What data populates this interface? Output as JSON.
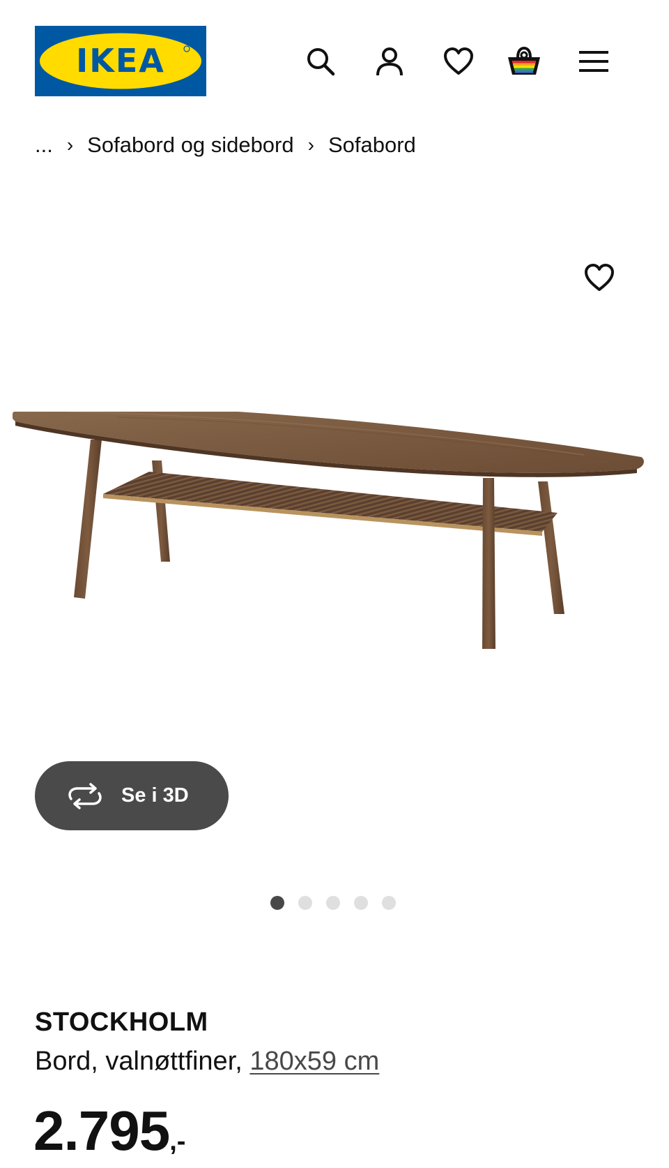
{
  "header": {
    "logo_text": "IKEA",
    "brand_colors": {
      "blue": "#0058a3",
      "yellow": "#ffdb00"
    },
    "icons": [
      "search-icon",
      "account-icon",
      "wishlist-icon",
      "basket-icon",
      "menu-icon"
    ]
  },
  "breadcrumb": {
    "ellipsis": "...",
    "separator": "›",
    "items": [
      {
        "label": "Sofabord og sidebord"
      },
      {
        "label": "Sofabord"
      }
    ]
  },
  "gallery": {
    "image_alt": "STOCKHOLM Bord, valnøttfiner",
    "view_3d_label": "Se i 3D",
    "slide_count": 5,
    "active_slide": 1
  },
  "product": {
    "name": "STOCKHOLM",
    "description": "Bord, valnøttfiner,",
    "size_link": "180x59 cm",
    "price_main": "2.795",
    "price_suffix": ",-"
  }
}
